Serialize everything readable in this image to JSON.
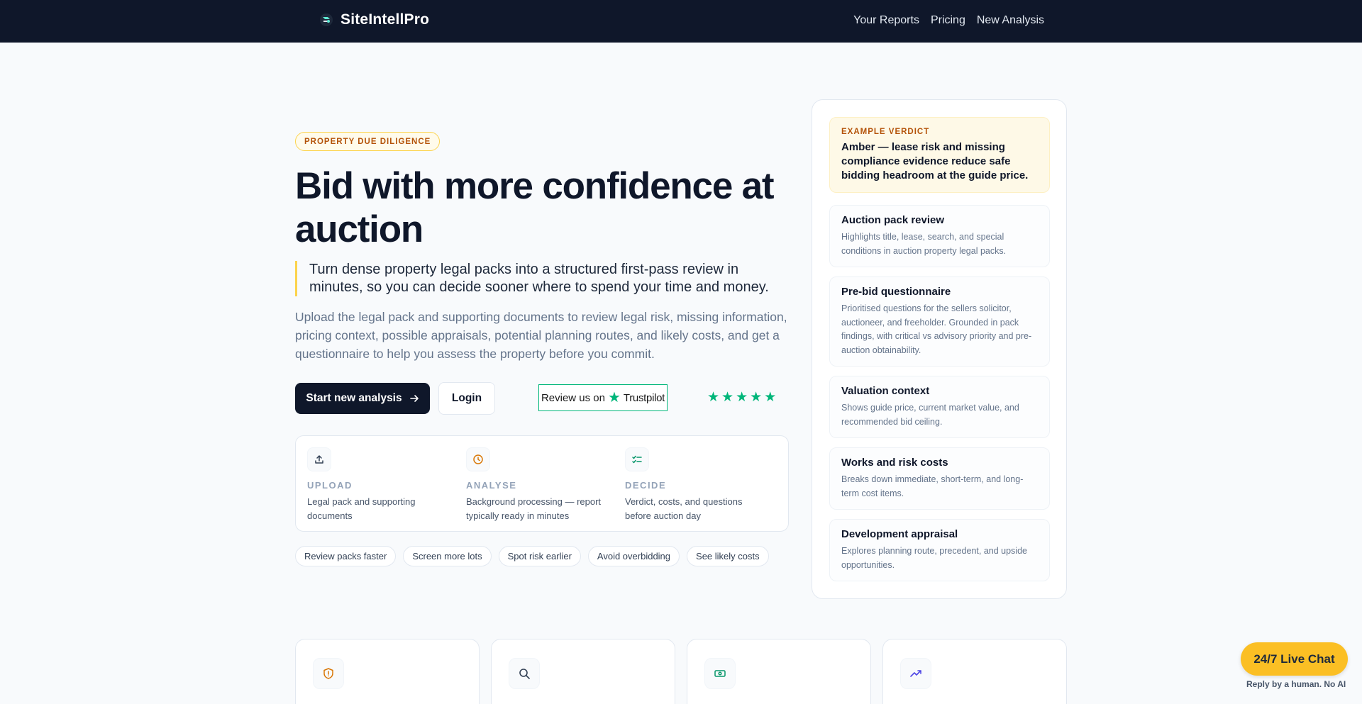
{
  "header": {
    "brand": "SiteIntellPro",
    "nav": [
      "Your Reports",
      "Pricing",
      "New Analysis"
    ]
  },
  "hero": {
    "pill": "PROPERTY DUE DILIGENCE",
    "title": "Bid with more confidence at auction",
    "lead": "Turn dense property legal packs into a structured first-pass review in minutes, so you can decide sooner where to spend your time and money.",
    "sub": "Upload the legal pack and supporting documents to review legal risk, missing information, pricing context, possible appraisals, potential planning routes, and likely costs, and get a questionnaire to help you assess the property before you commit.",
    "primary_cta": "Start new analysis",
    "secondary_cta": "Login",
    "trustpilot": {
      "prefix": "Review us on",
      "brand": "Trustpilot"
    },
    "rating": {
      "stars": 5,
      "max": 5
    }
  },
  "steps": [
    {
      "title": "UPLOAD",
      "desc": "Legal pack and supporting documents",
      "icon": "upload-icon"
    },
    {
      "title": "ANALYSE",
      "desc": "Background processing — report typically ready in minutes",
      "icon": "clock-icon"
    },
    {
      "title": "DECIDE",
      "desc": "Verdict, costs, and questions before auction day",
      "icon": "checklist-icon"
    }
  ],
  "chips": [
    "Review packs faster",
    "Screen more lots",
    "Spot risk earlier",
    "Avoid overbidding",
    "See likely costs"
  ],
  "panel": {
    "verdict_label": "EXAMPLE VERDICT",
    "verdict_text": "Amber — lease risk and missing compliance evidence reduce safe bidding headroom at the guide price.",
    "features": [
      {
        "title": "Auction pack review",
        "desc": "Highlights title, lease, search, and special conditions in auction property legal packs."
      },
      {
        "title": "Pre-bid questionnaire",
        "desc": "Prioritised questions for the sellers solicitor, auctioneer, and freeholder. Grounded in pack findings, with critical vs advisory priority and pre-auction obtainability."
      },
      {
        "title": "Valuation context",
        "desc": "Shows guide price, current market value, and recommended bid ceiling."
      },
      {
        "title": "Works and risk costs",
        "desc": "Breaks down immediate, short-term, and long-term cost items."
      },
      {
        "title": "Development appraisal",
        "desc": "Explores planning route, precedent, and upside opportunities."
      }
    ]
  },
  "bottom_cards": [
    {
      "icon": "shield-alert-icon"
    },
    {
      "icon": "search-icon"
    },
    {
      "icon": "banknote-icon"
    },
    {
      "icon": "trending-up-icon"
    }
  ],
  "chat": {
    "button": "24/7 Live Chat",
    "note": "Reply by a human. No AI"
  },
  "colors": {
    "navy": "#0f172a",
    "amber": "#fbbf24",
    "trustpilot_green": "#00b67a"
  }
}
